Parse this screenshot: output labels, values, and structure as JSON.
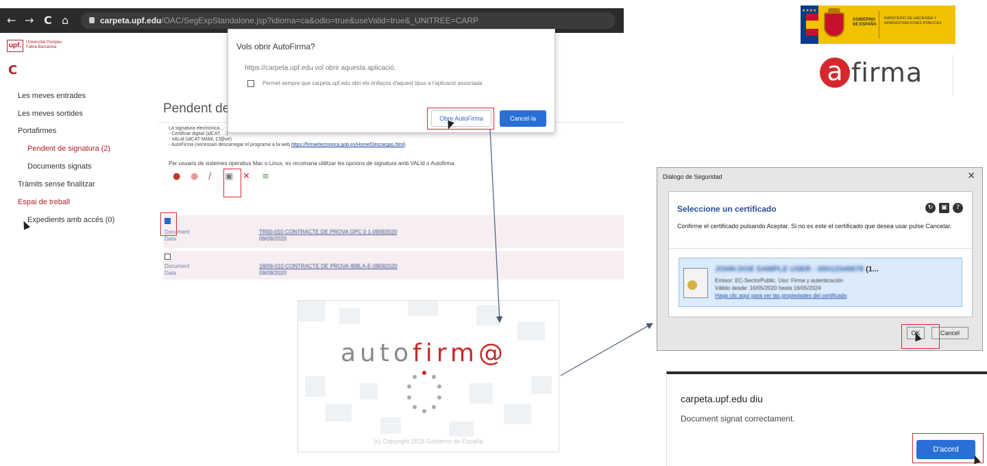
{
  "browser": {
    "nav_back": "←",
    "nav_forward": "→",
    "nav_reload": "C",
    "nav_home": "⌂",
    "url_host": "carpeta.upf.edu",
    "url_path": "/OAC/SegExpStandalone.jsp?idioma=ca&odio=true&useValid=true&_UNITREE=CARP",
    "logo_mark": "upf.",
    "logo_name": "Universitat Pompeu Fabra Barcelona",
    "reload_icon": "C"
  },
  "sidebar": {
    "items": [
      {
        "label": "Les meves entrades"
      },
      {
        "label": "Les meves sortides"
      },
      {
        "label": "Portafirmes"
      },
      {
        "label": "Pendent de signatura (2)"
      },
      {
        "label": "Documents signats"
      },
      {
        "label": "Tràmits sense finalitzar"
      },
      {
        "label": "Espai de treball"
      },
      {
        "label": "Expedients amb accés (0)"
      }
    ]
  },
  "content": {
    "title": "Pendent de",
    "info_lines": [
      "La signatura electrònica...",
      "- Certificat digital (idCAT, ...)",
      "- VALId (idCAT Mòbil, Cl@ve)",
      "- AutoFirma (necessari descarregar el programa a la web "
    ],
    "info_link": "https://firmaelectronica.gob.es/Home/Descargas.html",
    "info_tail": ")",
    "note": "Per usuaris de sistemes operatius Mac o Linux, es recomana utilitzar les opcions de signatura amb VALId o Autofirma.",
    "documents": [
      {
        "label_doc": "Document",
        "label_date": "Data",
        "name": "TR00-010 CONTRACTE DE PROVA GPC 0 1-09092020",
        "date": "09/09/2020"
      },
      {
        "label_doc": "Document",
        "label_date": "Data",
        "name": "18/09-010 CONTRACTE DE PROVA IBBLA-E-09092020",
        "date": "09/09/2020"
      }
    ]
  },
  "toolbar": {
    "icons": [
      "sign-icon",
      "sign-alt-icon",
      "pencil-icon",
      "autofirma-icon",
      "delete-icon",
      "list-icon"
    ]
  },
  "permission_dialog": {
    "title": "Vols obrir AutoFirma?",
    "message": "https://carpeta.upf.edu vol obrir aquesta aplicació.",
    "checkbox_label": "Permet sempre que carpeta.upf.edu obri els enllaços d'aquest tipus a l'aplicació associada",
    "open_button": "Obre AutoFirma",
    "cancel_button": "Cancel·la"
  },
  "gov_logo": {
    "name": "GOBIERNO DE ESPAÑA",
    "ministry": "MINISTERIO DE HACIENDA Y ADMINISTRACIONES PÚBLICAS"
  },
  "afirma_logo": {
    "a": "a",
    "text": "firma"
  },
  "splash": {
    "logo_prefix": "auto",
    "logo_hot": "firm@",
    "copyright": "(c) Copyright 2018 Gobierno de España"
  },
  "security_dialog": {
    "title": "Diálogo de Seguridad",
    "close": "✕",
    "heading": "Seleccione un certificado",
    "message": "Confirme el certificado pulsando Aceptar. Si no es este el certificado que desea usar pulse Cancelar.",
    "cert_name": "JOHN DOE SAMPLE USER - 00012345678",
    "cert_suffix": "(1...",
    "cert_issuer": "Emisor: EC-SectorPublic. Uso: Firma y autenticación",
    "cert_validity": "Válido desde: 16/05/2020 hasta 16/05/2024",
    "cert_link": "Haga clic aquí para ver las propiedades del certificado",
    "ok_button": "OK",
    "cancel_button": "Cancel"
  },
  "alert": {
    "title": "carpeta.upf.edu diu",
    "message": "Document signat correctament.",
    "ok_button": "D'acord"
  },
  "colors": {
    "highlight": "#d9262e",
    "upf_red": "#b0202a",
    "primary_blue": "#2a6fd6",
    "gov_yellow": "#f2c200"
  }
}
